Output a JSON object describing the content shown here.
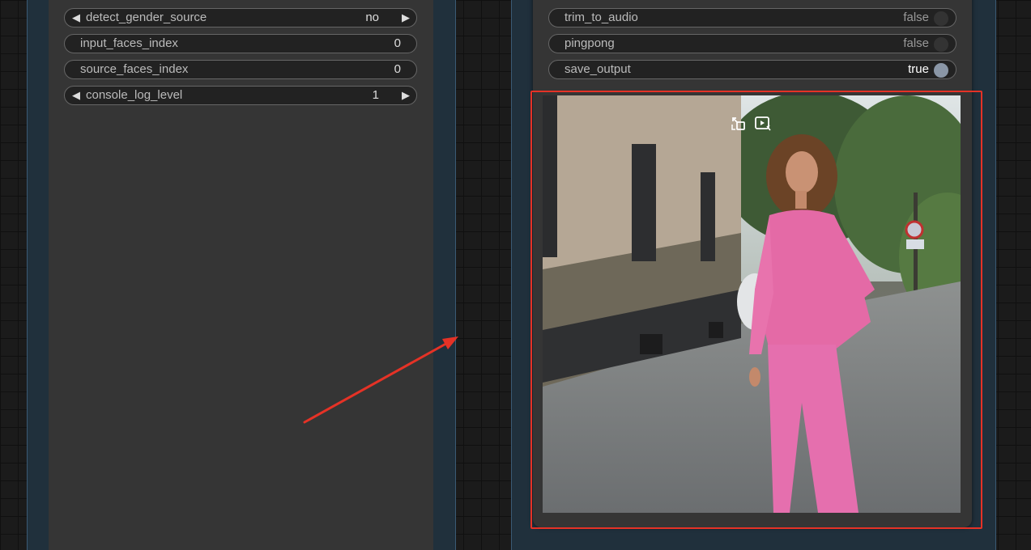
{
  "left_node": {
    "widgets": [
      {
        "label": "detect_gender_source",
        "value": "no",
        "type": "combo"
      },
      {
        "label": "input_faces_index",
        "value": "0",
        "type": "text"
      },
      {
        "label": "source_faces_index",
        "value": "0",
        "type": "text"
      },
      {
        "label": "console_log_level",
        "value": "1",
        "type": "combo"
      }
    ]
  },
  "right_node": {
    "widgets": [
      {
        "label": "trim_to_audio",
        "value": "false",
        "state": false
      },
      {
        "label": "pingpong",
        "value": "false",
        "state": false
      },
      {
        "label": "save_output",
        "value": "true",
        "state": true
      }
    ],
    "preview": {
      "icons": [
        "preview-collapse-icon",
        "preview-play-icon"
      ],
      "subject": "woman in pink outfit walking on cobblestone street"
    }
  },
  "colors": {
    "highlight": "#e53226",
    "annotation_arrow": "#e53226",
    "toggle_on": "#8a96a6"
  }
}
